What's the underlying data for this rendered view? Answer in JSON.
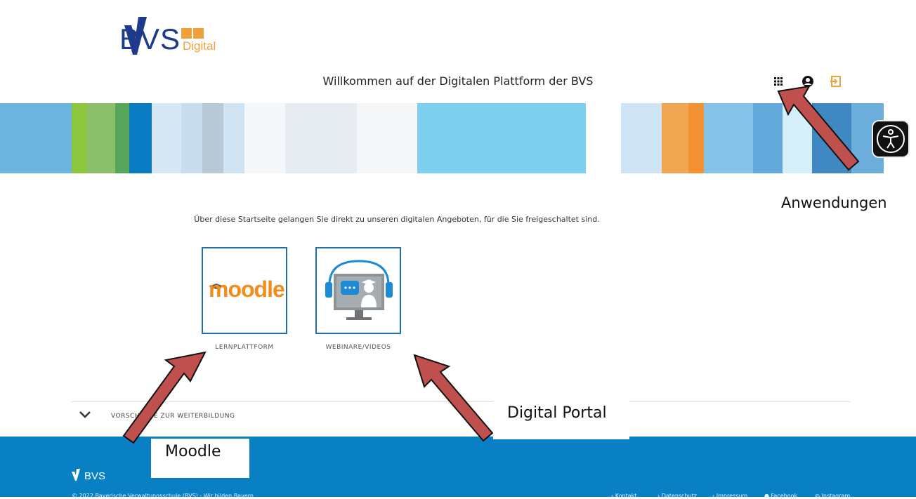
{
  "header": {
    "logo_word": "BVS",
    "logo_sub": "Digital",
    "welcome": "Willkommen auf der Digitalen Plattform der BVS",
    "icons": [
      "apps-grid-icon",
      "user-icon",
      "login-icon"
    ]
  },
  "banner_colors": [
    "#6cb4e0",
    "#8cc63f",
    "#8cbf6a",
    "#55a65a",
    "#0a7cc4",
    "#d6e8f5",
    "#c7dcec",
    "#b9c9d6",
    "#cfe3f3",
    "#f5f8fb",
    "#e6ecf1",
    "#f4f6f8",
    "#7ccfee",
    "#ffffff",
    "#cfe4f5",
    "#f0a550",
    "#f39233",
    "#86c3e8",
    "#63a9dc",
    "#d6f0fb",
    "#3f88c2",
    "#6baedc"
  ],
  "accessibility": {
    "icon": "accessibility-person-icon"
  },
  "main": {
    "intro": "Über diese Startseite gelangen Sie direkt zu unseren digitalen Angeboten, für die Sie freigeschaltet sind.",
    "tiles": [
      {
        "logo_text": "moodle",
        "label": "LERNPLATTFORM"
      },
      {
        "icon": "webinar-monitor-icon",
        "label": "WEBINARE/VIDEOS"
      }
    ],
    "accordion_label": "VORSCHLÄGE ZUR WEITERBILDUNG"
  },
  "footer": {
    "logo": "BVS",
    "copyright": "© 2022 Bayerische Verwaltungsschule (BVS) - Wir bilden Bayern",
    "links": [
      "› Kontakt",
      "› Datenschutz",
      "› Impressum",
      "Facebook",
      "Instagram"
    ]
  },
  "annotations": {
    "anwendungen": "Anwendungen",
    "digital_portal": "Digital Portal",
    "moodle": "Moodle",
    "arrow_color": "#c0504d"
  }
}
